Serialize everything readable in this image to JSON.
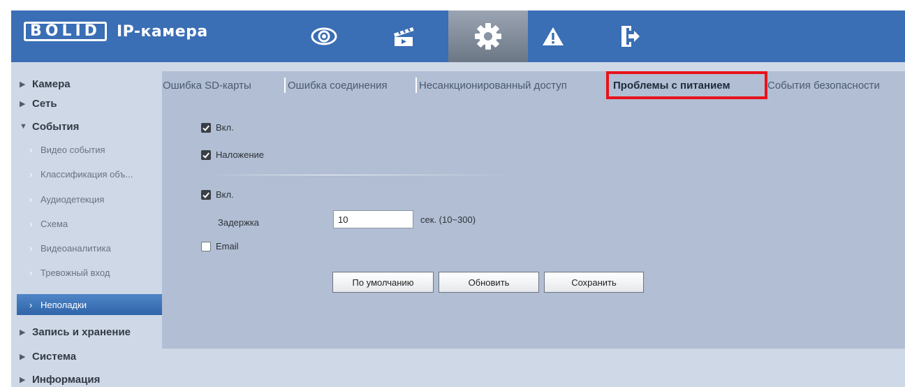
{
  "header": {
    "logo": "BOLID",
    "title": "IP-камера"
  },
  "nav": {
    "icons": [
      "eye-icon",
      "clapperboard-icon",
      "gear-icon",
      "warning-icon",
      "logout-icon"
    ],
    "active": "gear-icon"
  },
  "sidebar": {
    "items": [
      {
        "label": "Камера",
        "expanded": false
      },
      {
        "label": "Сеть",
        "expanded": false
      },
      {
        "label": "События",
        "expanded": true
      },
      {
        "label": "Запись и хранение",
        "expanded": false
      },
      {
        "label": "Система",
        "expanded": false
      },
      {
        "label": "Информация",
        "expanded": false
      }
    ],
    "events_children": [
      {
        "label": "Видео события"
      },
      {
        "label": "Классификация объ..."
      },
      {
        "label": "Аудиодетекция"
      },
      {
        "label": "Схема"
      },
      {
        "label": "Видеоаналитика"
      },
      {
        "label": "Тревожный вход"
      },
      {
        "label": "Неполадки",
        "active": true
      }
    ]
  },
  "tabs": [
    {
      "label": "Ошибка SD-карты"
    },
    {
      "label": "Ошибка соединения"
    },
    {
      "label": "Несанкционированный доступ"
    },
    {
      "label": "Проблемы с питанием",
      "active": true
    },
    {
      "label": "События безопасности"
    }
  ],
  "form": {
    "enable_label": "Вкл.",
    "enable_checked": true,
    "overlay_label": "Наложение",
    "overlay_checked": true,
    "enable2_label": "Вкл.",
    "enable2_checked": true,
    "delay_label": "Задержка",
    "delay_value": "10",
    "delay_hint": "сек. (10~300)",
    "email_label": "Email",
    "email_checked": false
  },
  "buttons": {
    "default": "По умолчанию",
    "refresh": "Обновить",
    "save": "Сохранить"
  },
  "colors": {
    "header_bg": "#3a6eb5",
    "highlight": "#e8121b",
    "active_menu": "#3a72b8"
  }
}
